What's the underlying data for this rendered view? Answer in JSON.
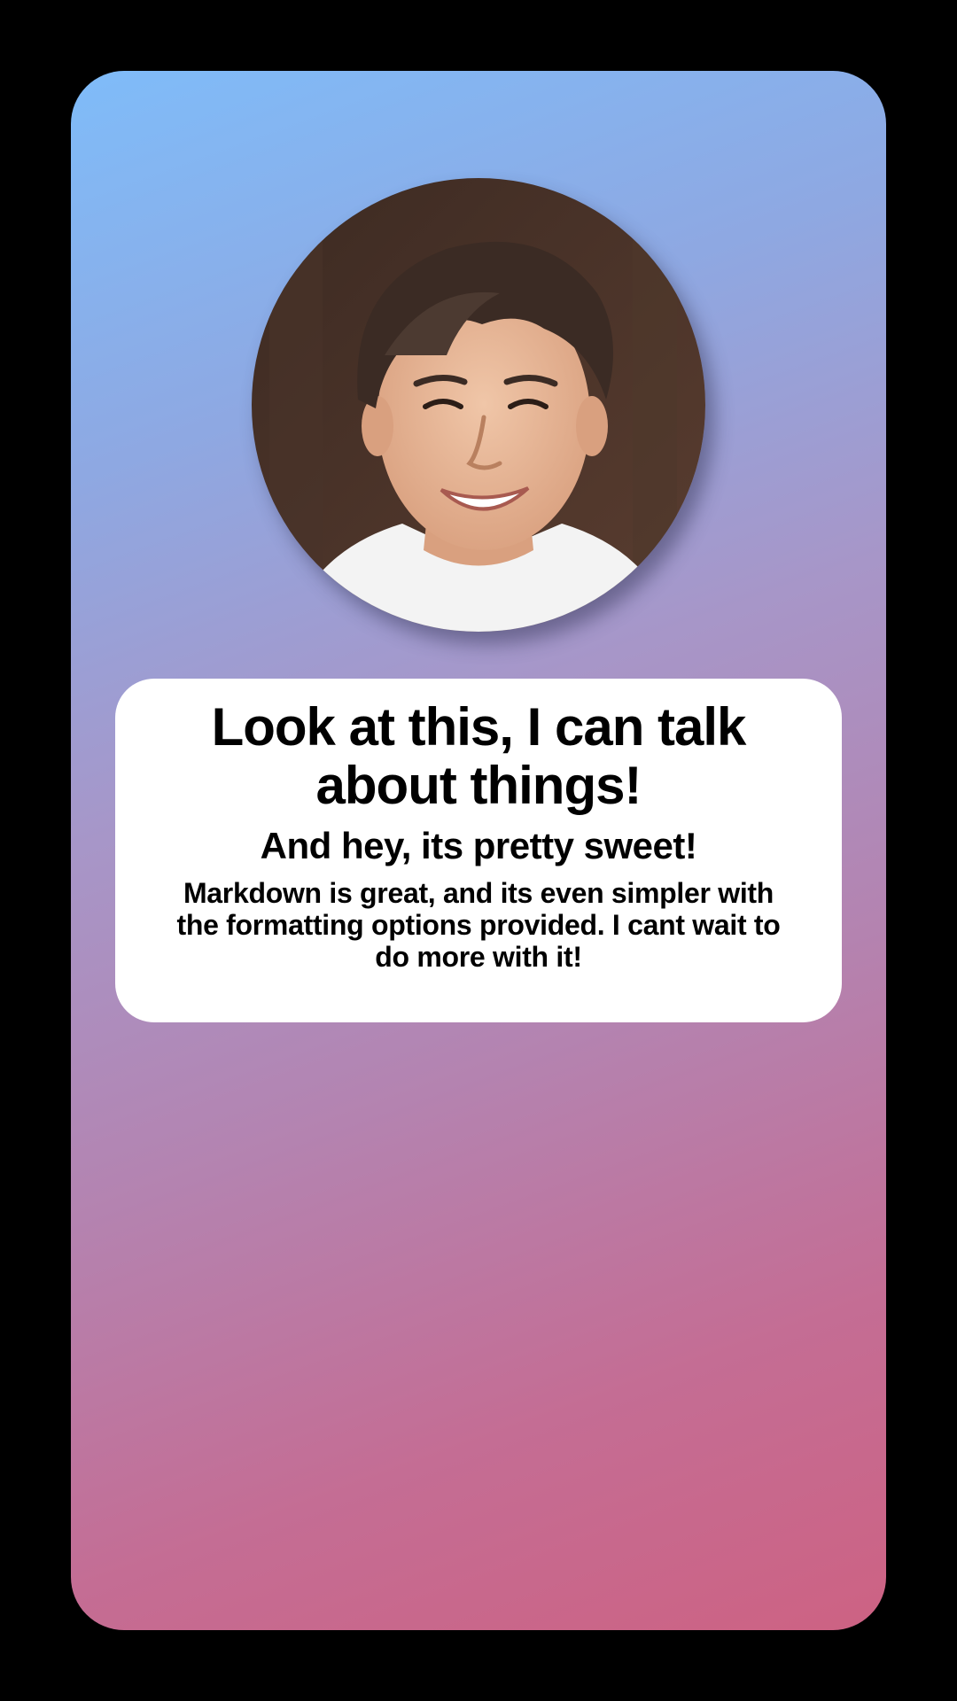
{
  "profile": {
    "avatar_icon": "portrait-photo-icon"
  },
  "message": {
    "heading": "Look at this, I can talk about things!",
    "subheading": "And hey, its pretty sweet!",
    "body": "Markdown is great, and its even simpler with the formatting options provided. I cant wait to do more with it!"
  },
  "colors": {
    "page_background": "#000000",
    "gradient_start": "#7fbcf9",
    "gradient_end": "#cd6283",
    "card_background": "#ffffff",
    "text": "#000000"
  }
}
